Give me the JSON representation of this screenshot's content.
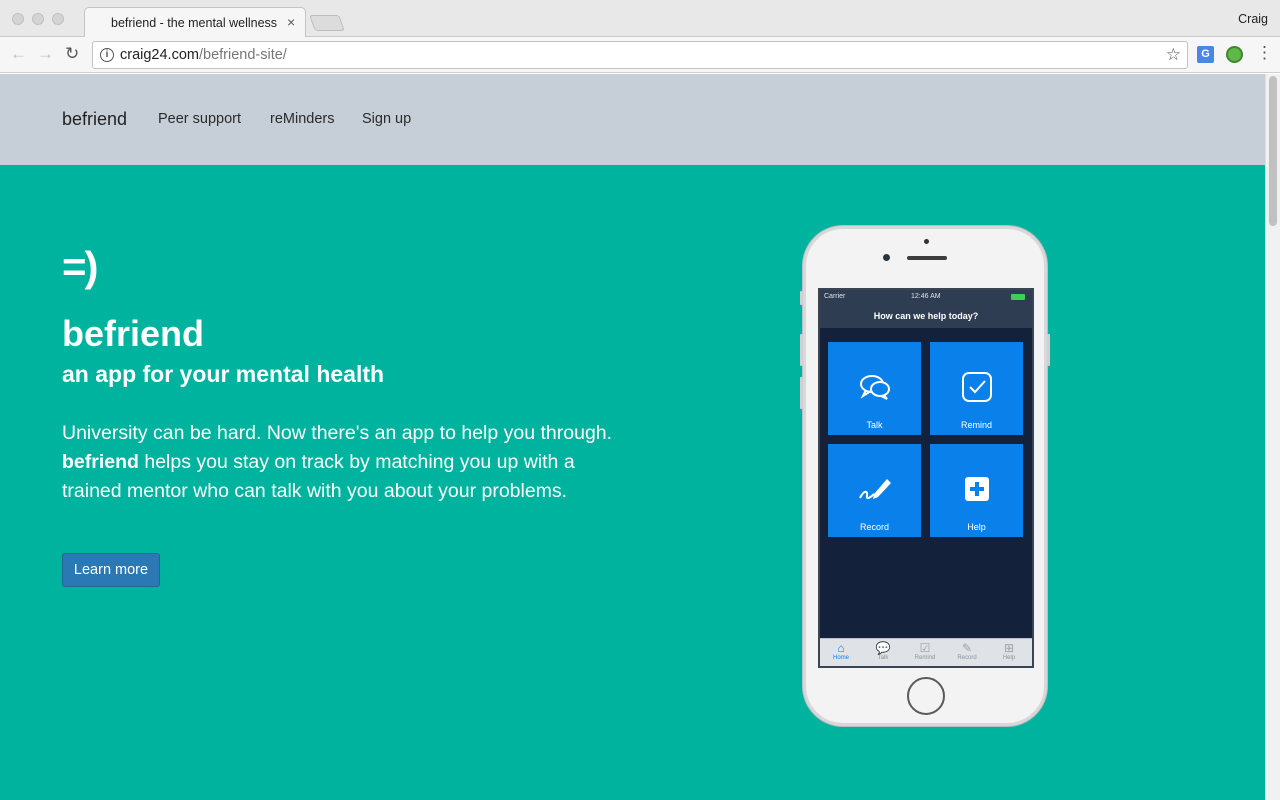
{
  "browser": {
    "tab_title": "befriend - the mental wellness",
    "tab_close": "×",
    "profile_name": "Craig",
    "url_host": "craig24.com",
    "url_path": "/befriend-site/",
    "back_icon": "←",
    "forward_icon": "→",
    "reload_icon": "↻",
    "info_icon": "i",
    "star_icon": "☆",
    "translate_icon": "G",
    "menu_icon": "⋮"
  },
  "nav": {
    "brand": "befriend",
    "links": [
      "Peer support",
      "reMinders",
      "Sign up"
    ]
  },
  "hero": {
    "logo": "=)",
    "title": "befriend",
    "subtitle": "an app for your mental health",
    "body_line1": "University can be hard. Now there's an app to help you through.",
    "body_bold": "befriend",
    "body_rest": " helps you stay on track by matching you up with a trained mentor who can talk with you about your problems.",
    "cta": "Learn more"
  },
  "phone": {
    "carrier": "Carrier",
    "time": "12:46 AM",
    "header": "How can we help today?",
    "tiles": [
      {
        "label": "Talk",
        "icon": "speech-bubbles-icon"
      },
      {
        "label": "Remind",
        "icon": "checkbox-icon"
      },
      {
        "label": "Record",
        "icon": "pen-signature-icon"
      },
      {
        "label": "Help",
        "icon": "plus-box-icon"
      }
    ],
    "tabbar": [
      {
        "label": "Home",
        "icon": "home-icon",
        "active": true
      },
      {
        "label": "Talk",
        "icon": "speech-bubbles-icon",
        "active": false
      },
      {
        "label": "Remind",
        "icon": "checkbox-icon",
        "active": false
      },
      {
        "label": "Record",
        "icon": "pen-signature-icon",
        "active": false
      },
      {
        "label": "Help",
        "icon": "plus-box-icon",
        "active": false
      }
    ]
  },
  "colors": {
    "hero_bg": "#00b39e",
    "nav_bg": "#c6ced7",
    "button_bg": "#2a79b5",
    "tile_bg": "#0a80ea",
    "phone_screen_bg": "#14213a"
  }
}
